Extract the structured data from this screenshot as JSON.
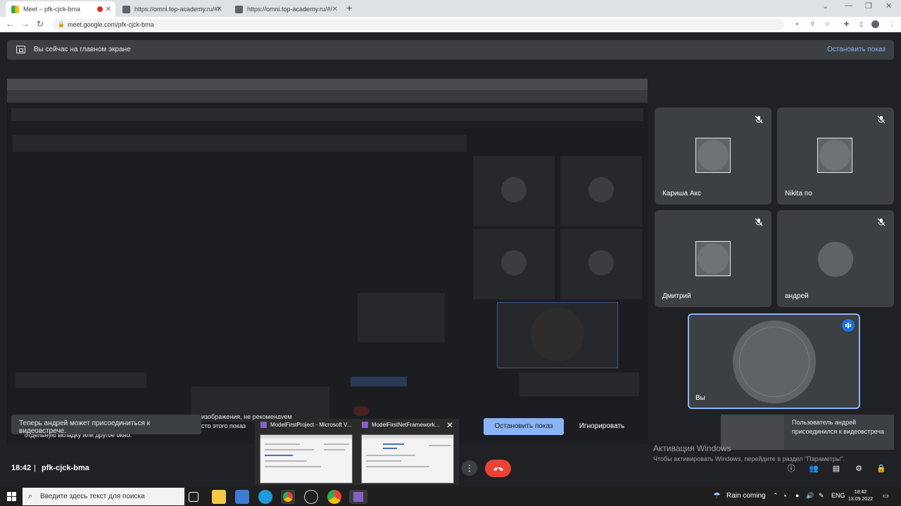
{
  "browser": {
    "tabs": [
      {
        "title": "Meet – pfk-cjck-bma",
        "active": true
      },
      {
        "title": "https://omni.top-academy.ru/#/",
        "active": false
      },
      {
        "title": "https://omni.top-academy.ru/#/",
        "active": false
      }
    ],
    "url": "meet.google.com/pfk-cjck-bma"
  },
  "banner": {
    "text": "Вы сейчас на главном экране",
    "stop_label": "Остановить показ"
  },
  "participants": [
    {
      "name": "Каришa Акс",
      "muted": true
    },
    {
      "name": "Nikita по",
      "muted": true
    },
    {
      "name": "Дмитрий",
      "muted": true
    },
    {
      "name": "андрей",
      "muted": true
    }
  ],
  "self": {
    "name": "Вы"
  },
  "toast": "Теперь андрей может присоединиться к видеовстрече.",
  "underlying_text": {
    "line1": "изображения, не рекомендуем",
    "line2": "сто этого показ",
    "line3": "отдельную вкладку или другое окно."
  },
  "thumbnails": [
    {
      "title": "ModelFirstProject - Microsoft V..."
    },
    {
      "title": "ModelFirstNetFramework..."
    }
  ],
  "actions": {
    "present_label": "Остановить показ",
    "ignore_label": "Игнорировать"
  },
  "notification": "Пользователь андрей присоединился к видеовстреча",
  "watermark": {
    "title": "Активация Windows",
    "subtitle": "Чтобы активировать Windows, перейдите в раздел \"Параметры\"."
  },
  "meeting": {
    "time": "18:42",
    "separator": "|",
    "code": "pfk-cjck-bma"
  },
  "taskbar": {
    "search_placeholder": "Введите здесь текст для поиска",
    "weather": "Rain coming",
    "lang": "ENG",
    "time": "18:42",
    "date": "13.09.2022"
  },
  "colors": {
    "accent": "#8ab4f8",
    "hangup": "#ea4335",
    "tile": "#3c4043",
    "speaking": "#1a73e8"
  }
}
